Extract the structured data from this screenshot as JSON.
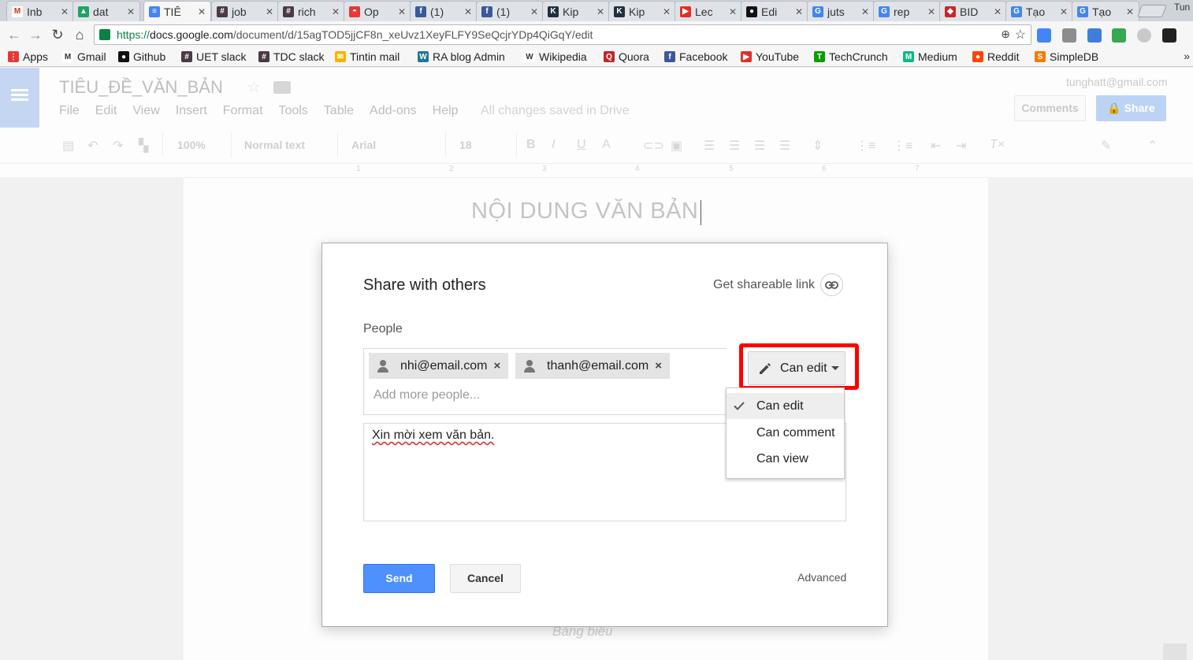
{
  "browser": {
    "tabs": [
      {
        "title": "Inb",
        "icon": "gmail-icon",
        "color": "#ffffff",
        "glyph": "M"
      },
      {
        "title": "dat",
        "icon": "drive-icon",
        "color": "#1fa463",
        "glyph": "▲"
      },
      {
        "title": "TIÊ",
        "icon": "docs-icon",
        "color": "#4285f4",
        "glyph": "≡",
        "active": true
      },
      {
        "title": "job",
        "icon": "slack-icon",
        "color": "#4a3a45",
        "glyph": "#"
      },
      {
        "title": "rich",
        "icon": "slack-icon",
        "color": "#4a3a45",
        "glyph": "#"
      },
      {
        "title": "Op",
        "icon": "pokeball-icon",
        "color": "#e53935",
        "glyph": "◓"
      },
      {
        "title": "(1)",
        "icon": "facebook-icon",
        "color": "#3b5998",
        "glyph": "f"
      },
      {
        "title": "(1)",
        "icon": "facebook-icon",
        "color": "#3b5998",
        "glyph": "f"
      },
      {
        "title": "Kip",
        "icon": "kipalog-icon",
        "color": "#1e3040",
        "glyph": "K"
      },
      {
        "title": "Kip",
        "icon": "kipalog-icon",
        "color": "#1e3040",
        "glyph": "K"
      },
      {
        "title": "Lec",
        "icon": "youtube-icon",
        "color": "#e52d27",
        "glyph": "▶"
      },
      {
        "title": "Edi",
        "icon": "github-icon",
        "color": "#111111",
        "glyph": "●"
      },
      {
        "title": "juts",
        "icon": "google-icon",
        "color": "#4285f4",
        "glyph": "G"
      },
      {
        "title": "rep",
        "icon": "google-icon",
        "color": "#4285f4",
        "glyph": "G"
      },
      {
        "title": "BID",
        "icon": "bidv-icon",
        "color": "#c62828",
        "glyph": "◆"
      },
      {
        "title": "Tạo",
        "icon": "google-icon",
        "color": "#4285f4",
        "glyph": "G"
      },
      {
        "title": "Tạo",
        "icon": "google-icon",
        "color": "#4285f4",
        "glyph": "G"
      }
    ],
    "profile": "Tun",
    "url": {
      "scheme": "https://",
      "host": "docs.google.com",
      "path": "/document/d/15agTOD5jjCF8n_xeUvz1XeyFLFY9SeQcjrYDp4QiGqY/edit"
    },
    "bookmarks": [
      {
        "label": "Apps",
        "icon": "apps-icon",
        "color": "#e53935",
        "glyph": "⋮"
      },
      {
        "label": "Gmail",
        "icon": "gmail-icon",
        "color": "#ffffff",
        "glyph": "M"
      },
      {
        "label": "Github",
        "icon": "github-icon",
        "color": "#111111",
        "glyph": "●"
      },
      {
        "label": "UET slack",
        "icon": "slack-icon",
        "color": "#4a3a45",
        "glyph": "#"
      },
      {
        "label": "TDC slack",
        "icon": "slack-icon",
        "color": "#4a3a45",
        "glyph": "#"
      },
      {
        "label": "Tintin mail",
        "icon": "mail-icon",
        "color": "#f5b400",
        "glyph": "✉"
      },
      {
        "label": "RA blog Admin",
        "icon": "wordpress-icon",
        "color": "#21759b",
        "glyph": "W"
      },
      {
        "label": "Wikipedia",
        "icon": "wikipedia-icon",
        "color": "#ffffff",
        "glyph": "W"
      },
      {
        "label": "Quora",
        "icon": "quora-icon",
        "color": "#b92b27",
        "glyph": "Q"
      },
      {
        "label": "Facebook",
        "icon": "facebook-icon",
        "color": "#3b5998",
        "glyph": "f"
      },
      {
        "label": "YouTube",
        "icon": "youtube-icon",
        "color": "#e52d27",
        "glyph": "▶"
      },
      {
        "label": "TechCrunch",
        "icon": "techcrunch-icon",
        "color": "#0a9e01",
        "glyph": "T"
      },
      {
        "label": "Medium",
        "icon": "medium-icon",
        "color": "#12b886",
        "glyph": "M"
      },
      {
        "label": "Reddit",
        "icon": "reddit-icon",
        "color": "#ff4500",
        "glyph": "●"
      },
      {
        "label": "SimpleDB",
        "icon": "simpledb-icon",
        "color": "#f57c00",
        "glyph": "S"
      }
    ],
    "bookmarks_more": "»"
  },
  "docs": {
    "title": "TIÊU_ĐỀ_VĂN_BẢN",
    "menu": [
      "File",
      "Edit",
      "View",
      "Insert",
      "Format",
      "Tools",
      "Table",
      "Add-ons",
      "Help"
    ],
    "save_status": "All changes saved in Drive",
    "account": "tunghatt@gmail.com",
    "comments_label": "Comments",
    "share_label": "Share",
    "toolbar": {
      "zoom": "100%",
      "style": "Normal text",
      "font": "Arial",
      "size": "18"
    },
    "ruler": [
      "1",
      "2",
      "3",
      "4",
      "5",
      "6",
      "7"
    ],
    "heading": "NỘI DUNG VĂN BẢN",
    "caption": "Bảng biểu"
  },
  "dialog": {
    "title": "Share with others",
    "shareable_link": "Get shareable link",
    "people_label": "People",
    "chips": [
      "nhi@email.com",
      "thanh@email.com"
    ],
    "chip_remove": "×",
    "add_placeholder": "Add more people...",
    "message": "Xin mời xem văn bản.",
    "send": "Send",
    "cancel": "Cancel",
    "advanced": "Advanced",
    "permission": "Can edit",
    "permission_options": [
      "Can edit",
      "Can comment",
      "Can view"
    ],
    "selected_option": "Can edit",
    "highlight_color": "#ff0000"
  }
}
